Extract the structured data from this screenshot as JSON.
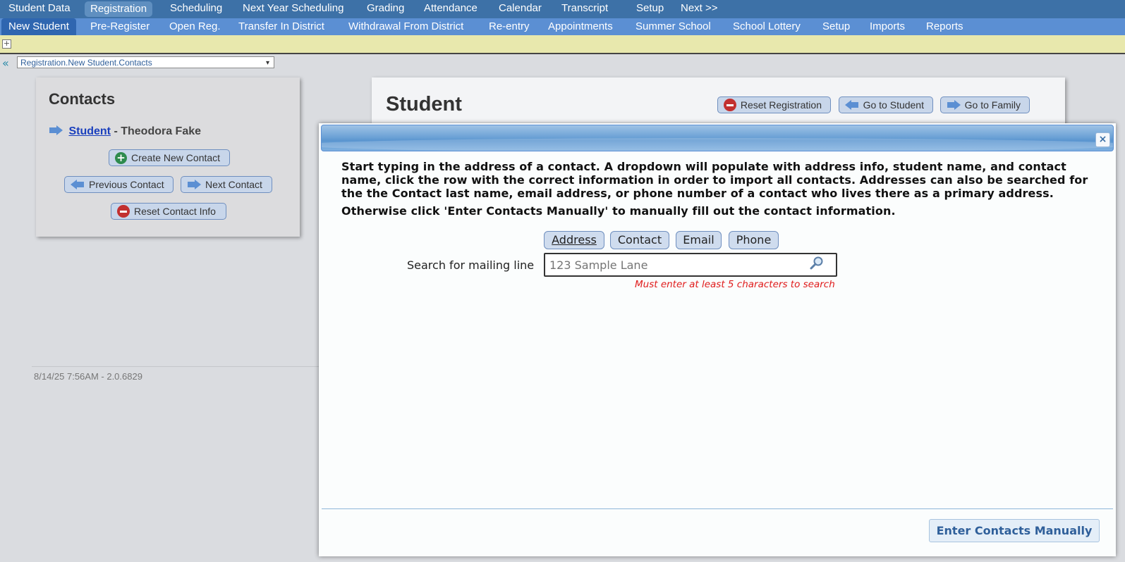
{
  "top_nav": {
    "items": [
      "Student Data",
      "Registration",
      "Scheduling",
      "Next Year Scheduling",
      "Grading",
      "Attendance",
      "Calendar",
      "Transcript",
      "Setup",
      "Next >>"
    ],
    "active": "Registration"
  },
  "sub_nav": {
    "items": [
      "New Student",
      "Pre-Register",
      "Open Reg.",
      "Transfer In District",
      "Withdrawal From District",
      "Re-entry",
      "Appointments",
      "Summer School",
      "School Lottery",
      "Setup",
      "Imports",
      "Reports"
    ],
    "active": "New Student"
  },
  "breadcrumb_select": {
    "value": "Registration.New Student.Contacts"
  },
  "contacts_panel": {
    "title": "Contacts",
    "student_link": "Student",
    "student_name": " - Theodora Fake",
    "create_button": "Create New Contact",
    "prev_button": "Previous Contact",
    "next_button": "Next Contact",
    "reset_button": "Reset Contact Info"
  },
  "footer": {
    "version_text": "8/14/25 7:56AM - 2.0.6829"
  },
  "student_panel": {
    "title": "Student",
    "reset_button": "Reset Registration",
    "go_student_button": "Go to Student",
    "go_family_button": "Go to Family"
  },
  "modal": {
    "instructions_1": "Start typing in the address of a contact. A dropdown will populate with address info, student name, and contact name, click the row with the correct information in order to import all contacts. Addresses can also be searched for the the Contact last name, email address, or phone number of a contact who lives there as a primary address.",
    "instructions_2": "Otherwise click 'Enter Contacts Manually' to manually fill out the contact information.",
    "tabs": [
      "Address",
      "Contact",
      "Email",
      "Phone"
    ],
    "active_tab": "Address",
    "search_label": "Search for mailing line",
    "search_placeholder": "123 Sample Lane",
    "search_value": "",
    "search_hint": "Must enter at least 5 characters to search",
    "manual_button": "Enter Contacts Manually",
    "close_label": "×"
  },
  "colors": {
    "top_nav_bg": "#3d71a7",
    "sub_nav_bg": "#5b8fd3",
    "accent_red": "#e01b1b",
    "link_blue": "#1a3fbd"
  }
}
